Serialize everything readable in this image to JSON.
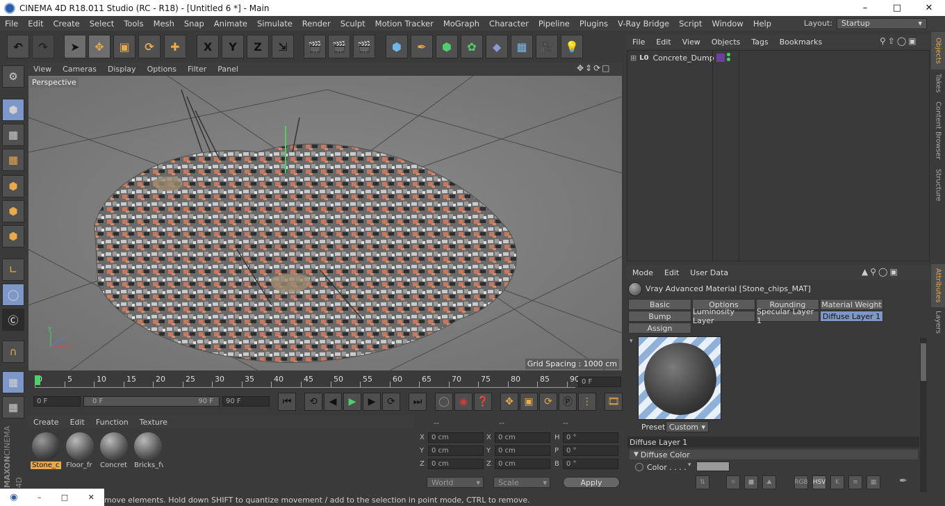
{
  "window": {
    "title": "CINEMA 4D R18.011 Studio (RC - R18) - [Untitled 6 *] - Main"
  },
  "menu": [
    "File",
    "Edit",
    "Create",
    "Select",
    "Tools",
    "Mesh",
    "Snap",
    "Animate",
    "Simulate",
    "Render",
    "Sculpt",
    "Motion Tracker",
    "MoGraph",
    "Character",
    "Pipeline",
    "Plugins",
    "V-Ray Bridge",
    "Script",
    "Window",
    "Help"
  ],
  "layout": {
    "label": "Layout:",
    "value": "Startup"
  },
  "toolbar": {
    "x_label": "X",
    "y_label": "Y",
    "z_label": "Z"
  },
  "viewport": {
    "menu": [
      "View",
      "Cameras",
      "Display",
      "Options",
      "Filter",
      "Panel"
    ],
    "camera_label": "Perspective",
    "grid_spacing": "Grid Spacing : 1000 cm"
  },
  "timeline": {
    "ticks": [
      "0",
      "5",
      "10",
      "15",
      "20",
      "25",
      "30",
      "35",
      "40",
      "45",
      "50",
      "55",
      "60",
      "65",
      "70",
      "75",
      "80",
      "85",
      "90"
    ],
    "current_frame": "0 F",
    "start_frame": "0 F",
    "range_start": "0 F",
    "range_end": "90 F",
    "end_frame": "90 F"
  },
  "materials": {
    "menu": [
      "Create",
      "Edit",
      "Function",
      "Texture"
    ],
    "items": [
      "Stone_c",
      "Floor_fr",
      "Concret",
      "Bricks_fv"
    ]
  },
  "coordinates": {
    "headers": [
      "--",
      "--",
      "--"
    ],
    "rows": [
      {
        "a": "X",
        "av": "0 cm",
        "b": "X",
        "bv": "0 cm",
        "c": "H",
        "cv": "0 °"
      },
      {
        "a": "Y",
        "av": "0 cm",
        "b": "Y",
        "bv": "0 cm",
        "c": "P",
        "cv": "0 °"
      },
      {
        "a": "Z",
        "av": "0 cm",
        "b": "Z",
        "bv": "0 cm",
        "c": "B",
        "cv": "0 °"
      }
    ],
    "world": "World",
    "scale": "Scale",
    "apply": "Apply"
  },
  "status_text": "move elements. Hold down SHIFT to quantize movement / add to the selection in point mode, CTRL to remove.",
  "objects": {
    "menu": [
      "File",
      "Edit",
      "View",
      "Objects",
      "Tags",
      "Bookmarks"
    ],
    "items": [
      "Concrete_Dump"
    ]
  },
  "attributes": {
    "menu": [
      "Mode",
      "Edit",
      "User Data"
    ],
    "material_title": "Vray Advanced Material [Stone_chips_MAT]",
    "tabs_row1": [
      "Basic",
      "Options",
      "Rounding",
      "Material Weight"
    ],
    "tabs_row2": [
      "Bump",
      "Luminosity Layer",
      "Specular Layer 1",
      "Diffuse Layer 1"
    ],
    "tabs_row3": [
      "Assign"
    ],
    "preset_label": "Preset",
    "preset_value": "Custom",
    "section_title": "Diffuse Layer 1",
    "sub_section": "Diffuse Color",
    "color_label": "Color . . . .",
    "color_modes": [
      "RGB",
      "HSV",
      "K"
    ]
  },
  "side_tabs": [
    "Objects",
    "Takes",
    "Content Browser",
    "Structure",
    "Attributes",
    "Layers"
  ],
  "branding": {
    "brand": "MAXON",
    "product": "CINEMA 4D"
  },
  "colors": {
    "accent": "#7d98c8",
    "orange": "#e8a94c",
    "background": "#3a3a3a"
  }
}
